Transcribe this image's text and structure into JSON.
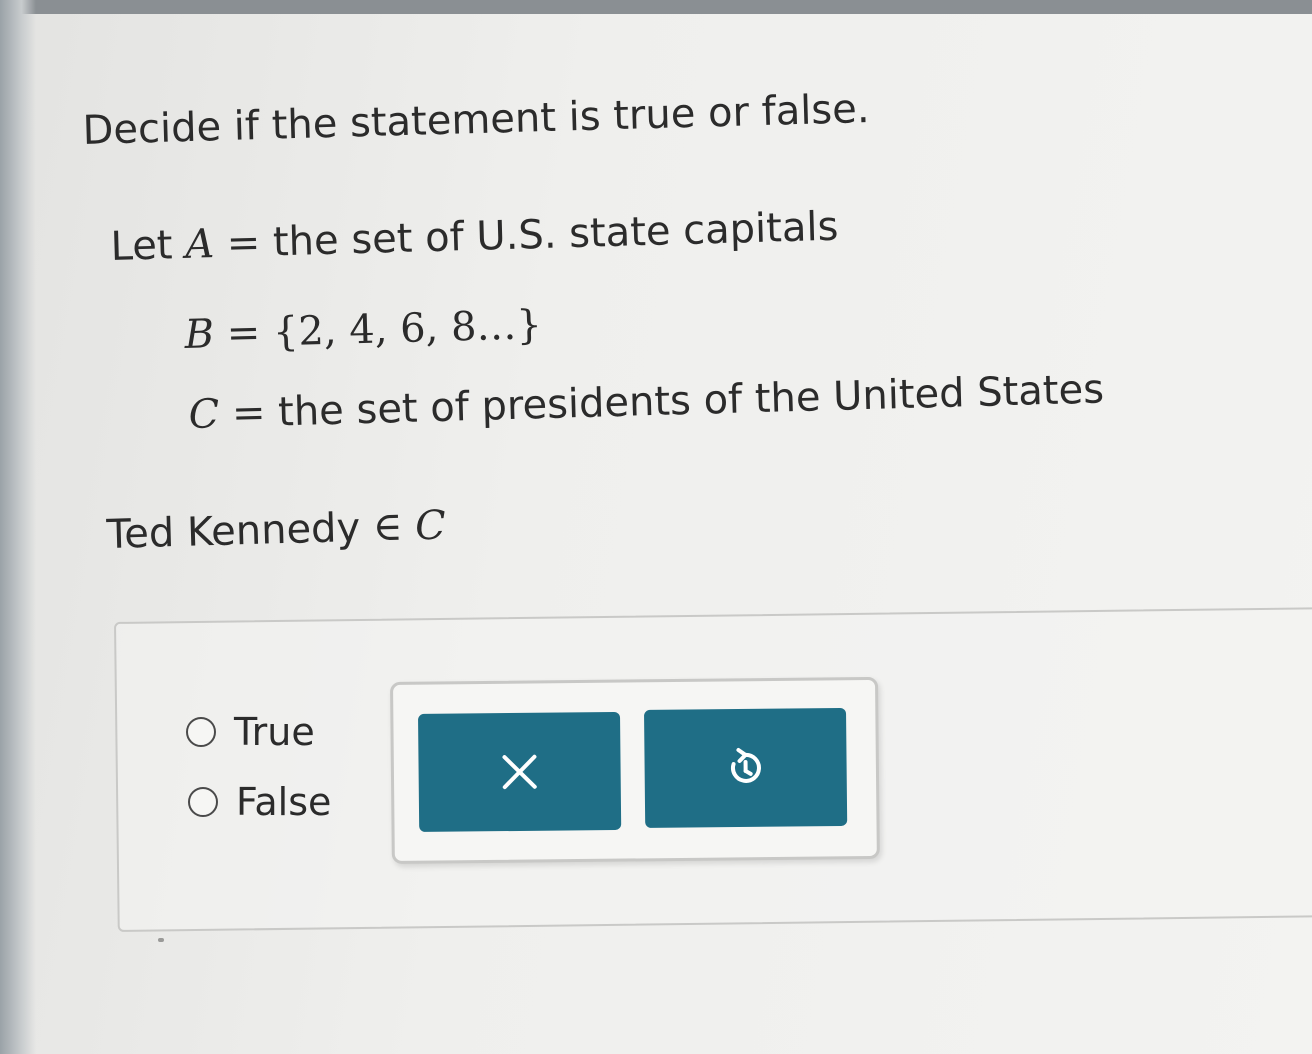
{
  "question": {
    "prompt": "Decide if the statement is true or false.",
    "definitions": {
      "let_word": "Let",
      "a_symbol": "A",
      "eq": "=",
      "a_text": "the set of U.S. state capitals",
      "b_symbol": "B",
      "b_text": "{2, 4, 6, 8…}",
      "c_symbol": "C",
      "c_text": "the set of presidents of the United States"
    },
    "statement": {
      "subject": "Ted Kennedy",
      "operator": "∈",
      "set": "C"
    }
  },
  "answer": {
    "options": [
      {
        "label": "True",
        "selected": false
      },
      {
        "label": "False",
        "selected": false
      }
    ]
  },
  "toolbar": {
    "clear_icon": "close-icon",
    "reset_icon": "undo-icon",
    "button_color": "#1f6e86"
  }
}
